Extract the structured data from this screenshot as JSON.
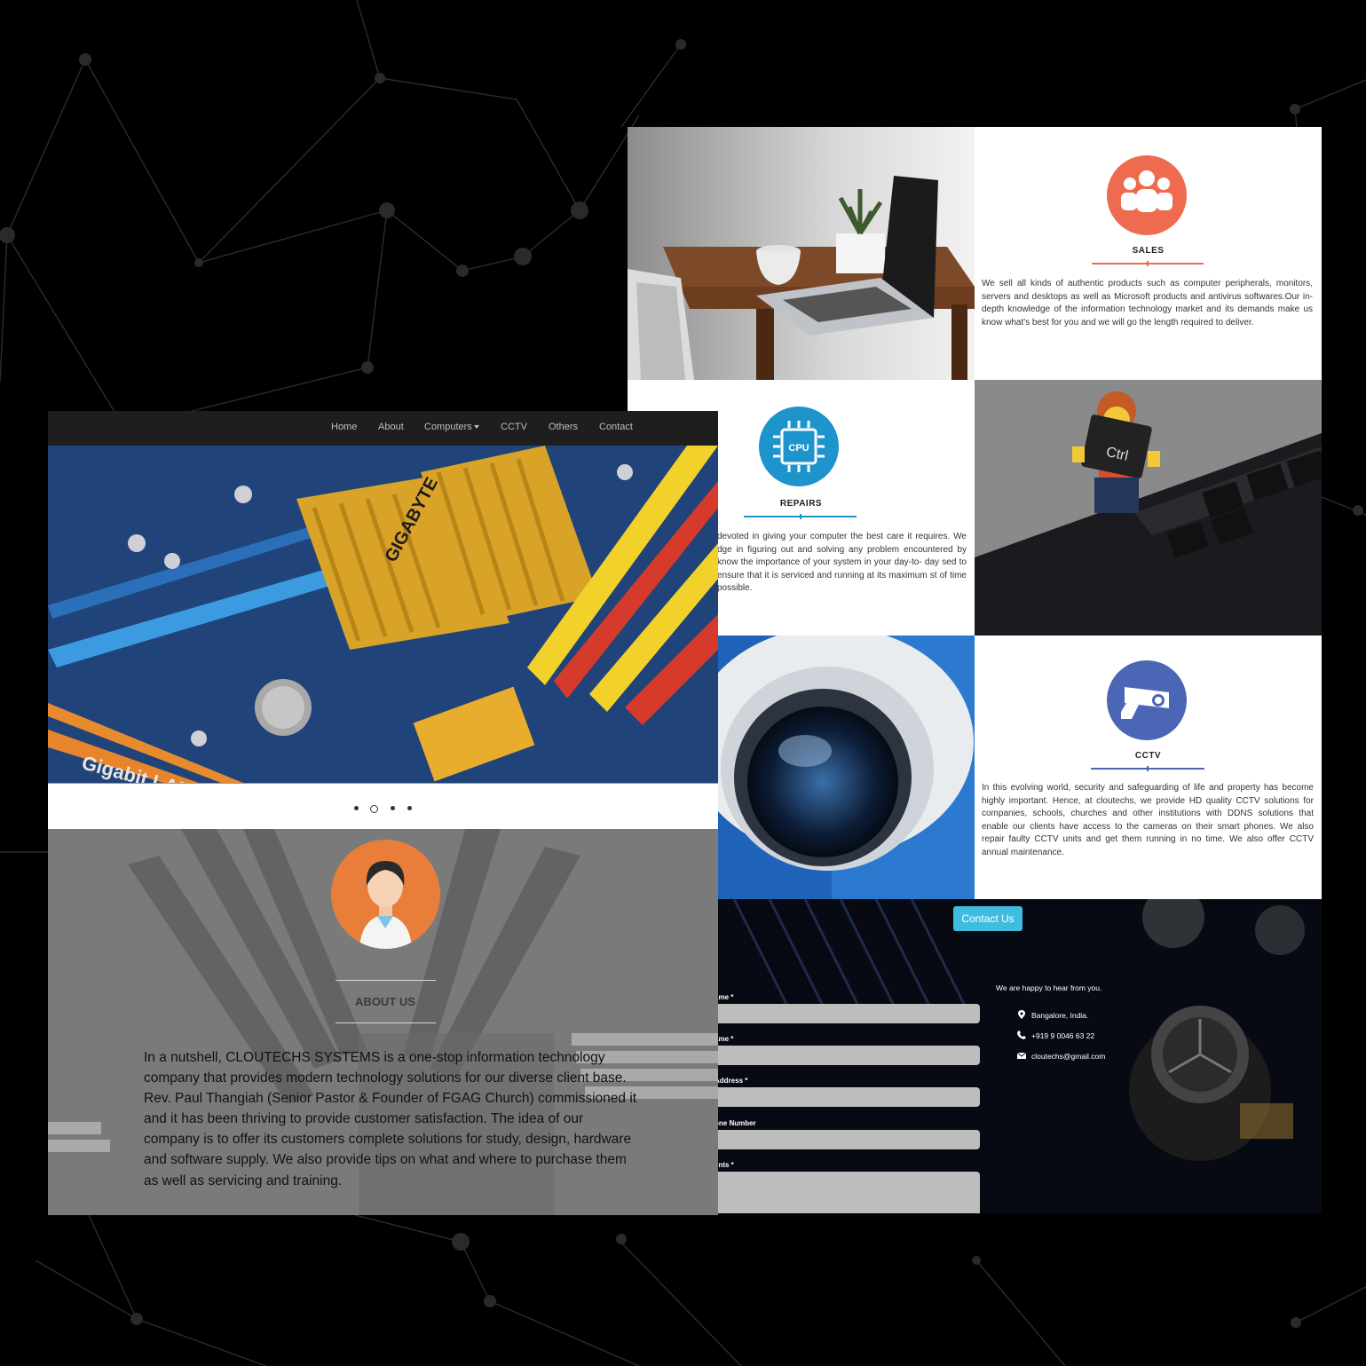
{
  "colors": {
    "background": "#000000",
    "sales_accent": "#ef6b50",
    "repairs_accent": "#1d94cc",
    "cctv_accent": "#4b66b5",
    "contact_button": "#3fbde0",
    "avatar_accent": "#e97e3a"
  },
  "navbar": {
    "items": [
      {
        "label": "Home"
      },
      {
        "label": "About"
      },
      {
        "label": "Computers"
      },
      {
        "label": "CCTV"
      },
      {
        "label": "Others"
      },
      {
        "label": "Contact"
      }
    ]
  },
  "carousel": {
    "slide_count": 4,
    "active_index": 1
  },
  "about": {
    "title": "ABOUT US",
    "paragraph_1": "In a nutshell, CLOUTECHS SYSTEMS is a one-stop information technology company that provides modern technology solutions for our diverse client base.",
    "paragraph_2": "Rev. Paul Thangiah (Senior Pastor & Founder of FGAG Church) commissioned it and it has been thriving to provide customer satisfaction. The idea of our company is to offer its customers complete solutions for study, design, hardware and software supply. We also provide tips on what and where to purchase them as well as servicing and training."
  },
  "services": {
    "sales": {
      "title": "SALES",
      "icon": "group-icon",
      "text": "We sell all kinds of authentic products such as computer peripherals, monitors, servers and desktops as well as Microsoft products and antivirus softwares.Our in-depth knowledge of the information technology market and its demands make us know what's best for you and we will go the length required to deliver."
    },
    "repairs": {
      "title": "REPAIRS",
      "icon": "cpu-icon",
      "icon_label": "CPU",
      "text": "devoted in giving your computer the best care it requires. We dge in figuring out and solving any problem encountered by know the importance of your system in your day-to- day sed to ensure that it is serviced and running at its maximum st of time possible."
    },
    "cctv": {
      "title": "CCTV",
      "icon": "cctv-camera-icon",
      "text": "In this evolving world, security and safeguarding of life and property has become highly important. Hence, at cloutechs, we provide HD quality CCTV solutions for companies, schools, churches and other institutions with DDNS solutions that enable our clients have access to the cameras on their smart phones. We also repair faulty CCTV units and get them running in no time. We also offer CCTV annual maintenance."
    }
  },
  "contact": {
    "button_label": "Contact Us",
    "fields": [
      {
        "label": "ame *"
      },
      {
        "label": "ame *"
      },
      {
        "label": "Address *"
      },
      {
        "label": "one Number"
      },
      {
        "label": "ents *"
      }
    ],
    "intro": "We are happy to hear from you.",
    "location": "Bangalore, India.",
    "phone": "+919 9 0046 63 22",
    "email": "cloutechs@gmail.com"
  }
}
